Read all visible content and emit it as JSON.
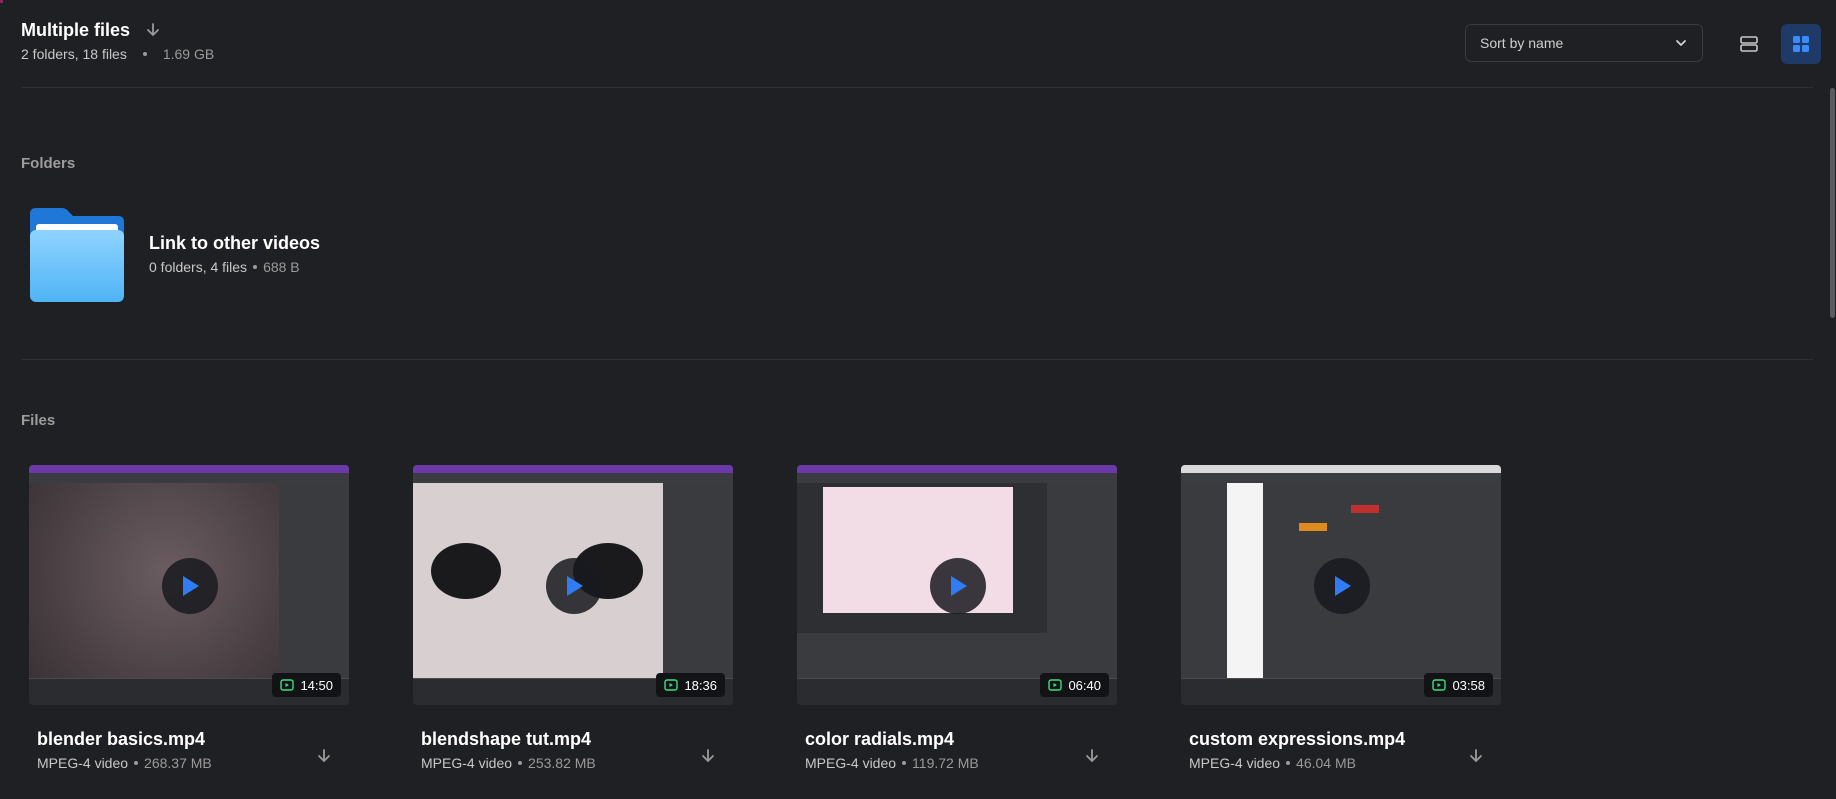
{
  "header": {
    "title": "Multiple files",
    "summary_counts": "2 folders, 18 files",
    "summary_size": "1.69 GB",
    "download_icon": "download-arrow-icon"
  },
  "toolbar": {
    "sort_label": "Sort by name",
    "sort_icon": "chevron-down-icon",
    "view_list_icon": "list-view-icon",
    "view_grid_icon": "grid-view-icon",
    "active_view": "grid",
    "accent": "#1f3a66",
    "accent_icon": "#3a8bff"
  },
  "sections": {
    "folders_label": "Folders",
    "files_label": "Files"
  },
  "folder": {
    "name": "Link to other videos",
    "counts": "0 folders, 4 files",
    "size": "688 B",
    "icon": "folder-icon"
  },
  "files": [
    {
      "name": "blender basics.mp4",
      "type": "MPEG-4 video",
      "size": "268.37 MB",
      "duration": "14:50",
      "thumb_color": "#4a3f44"
    },
    {
      "name": "blendshape tut.mp4",
      "type": "MPEG-4 video",
      "size": "253.82 MB",
      "duration": "18:36",
      "thumb_color": "#d8c9cc"
    },
    {
      "name": "color radials.mp4",
      "type": "MPEG-4 video",
      "size": "119.72 MB",
      "duration": "06:40",
      "thumb_color": "#f2dde6"
    },
    {
      "name": "custom expressions.mp4",
      "type": "MPEG-4 video",
      "size": "46.04 MB",
      "duration": "03:58",
      "thumb_color": "#3a3b3f"
    }
  ]
}
